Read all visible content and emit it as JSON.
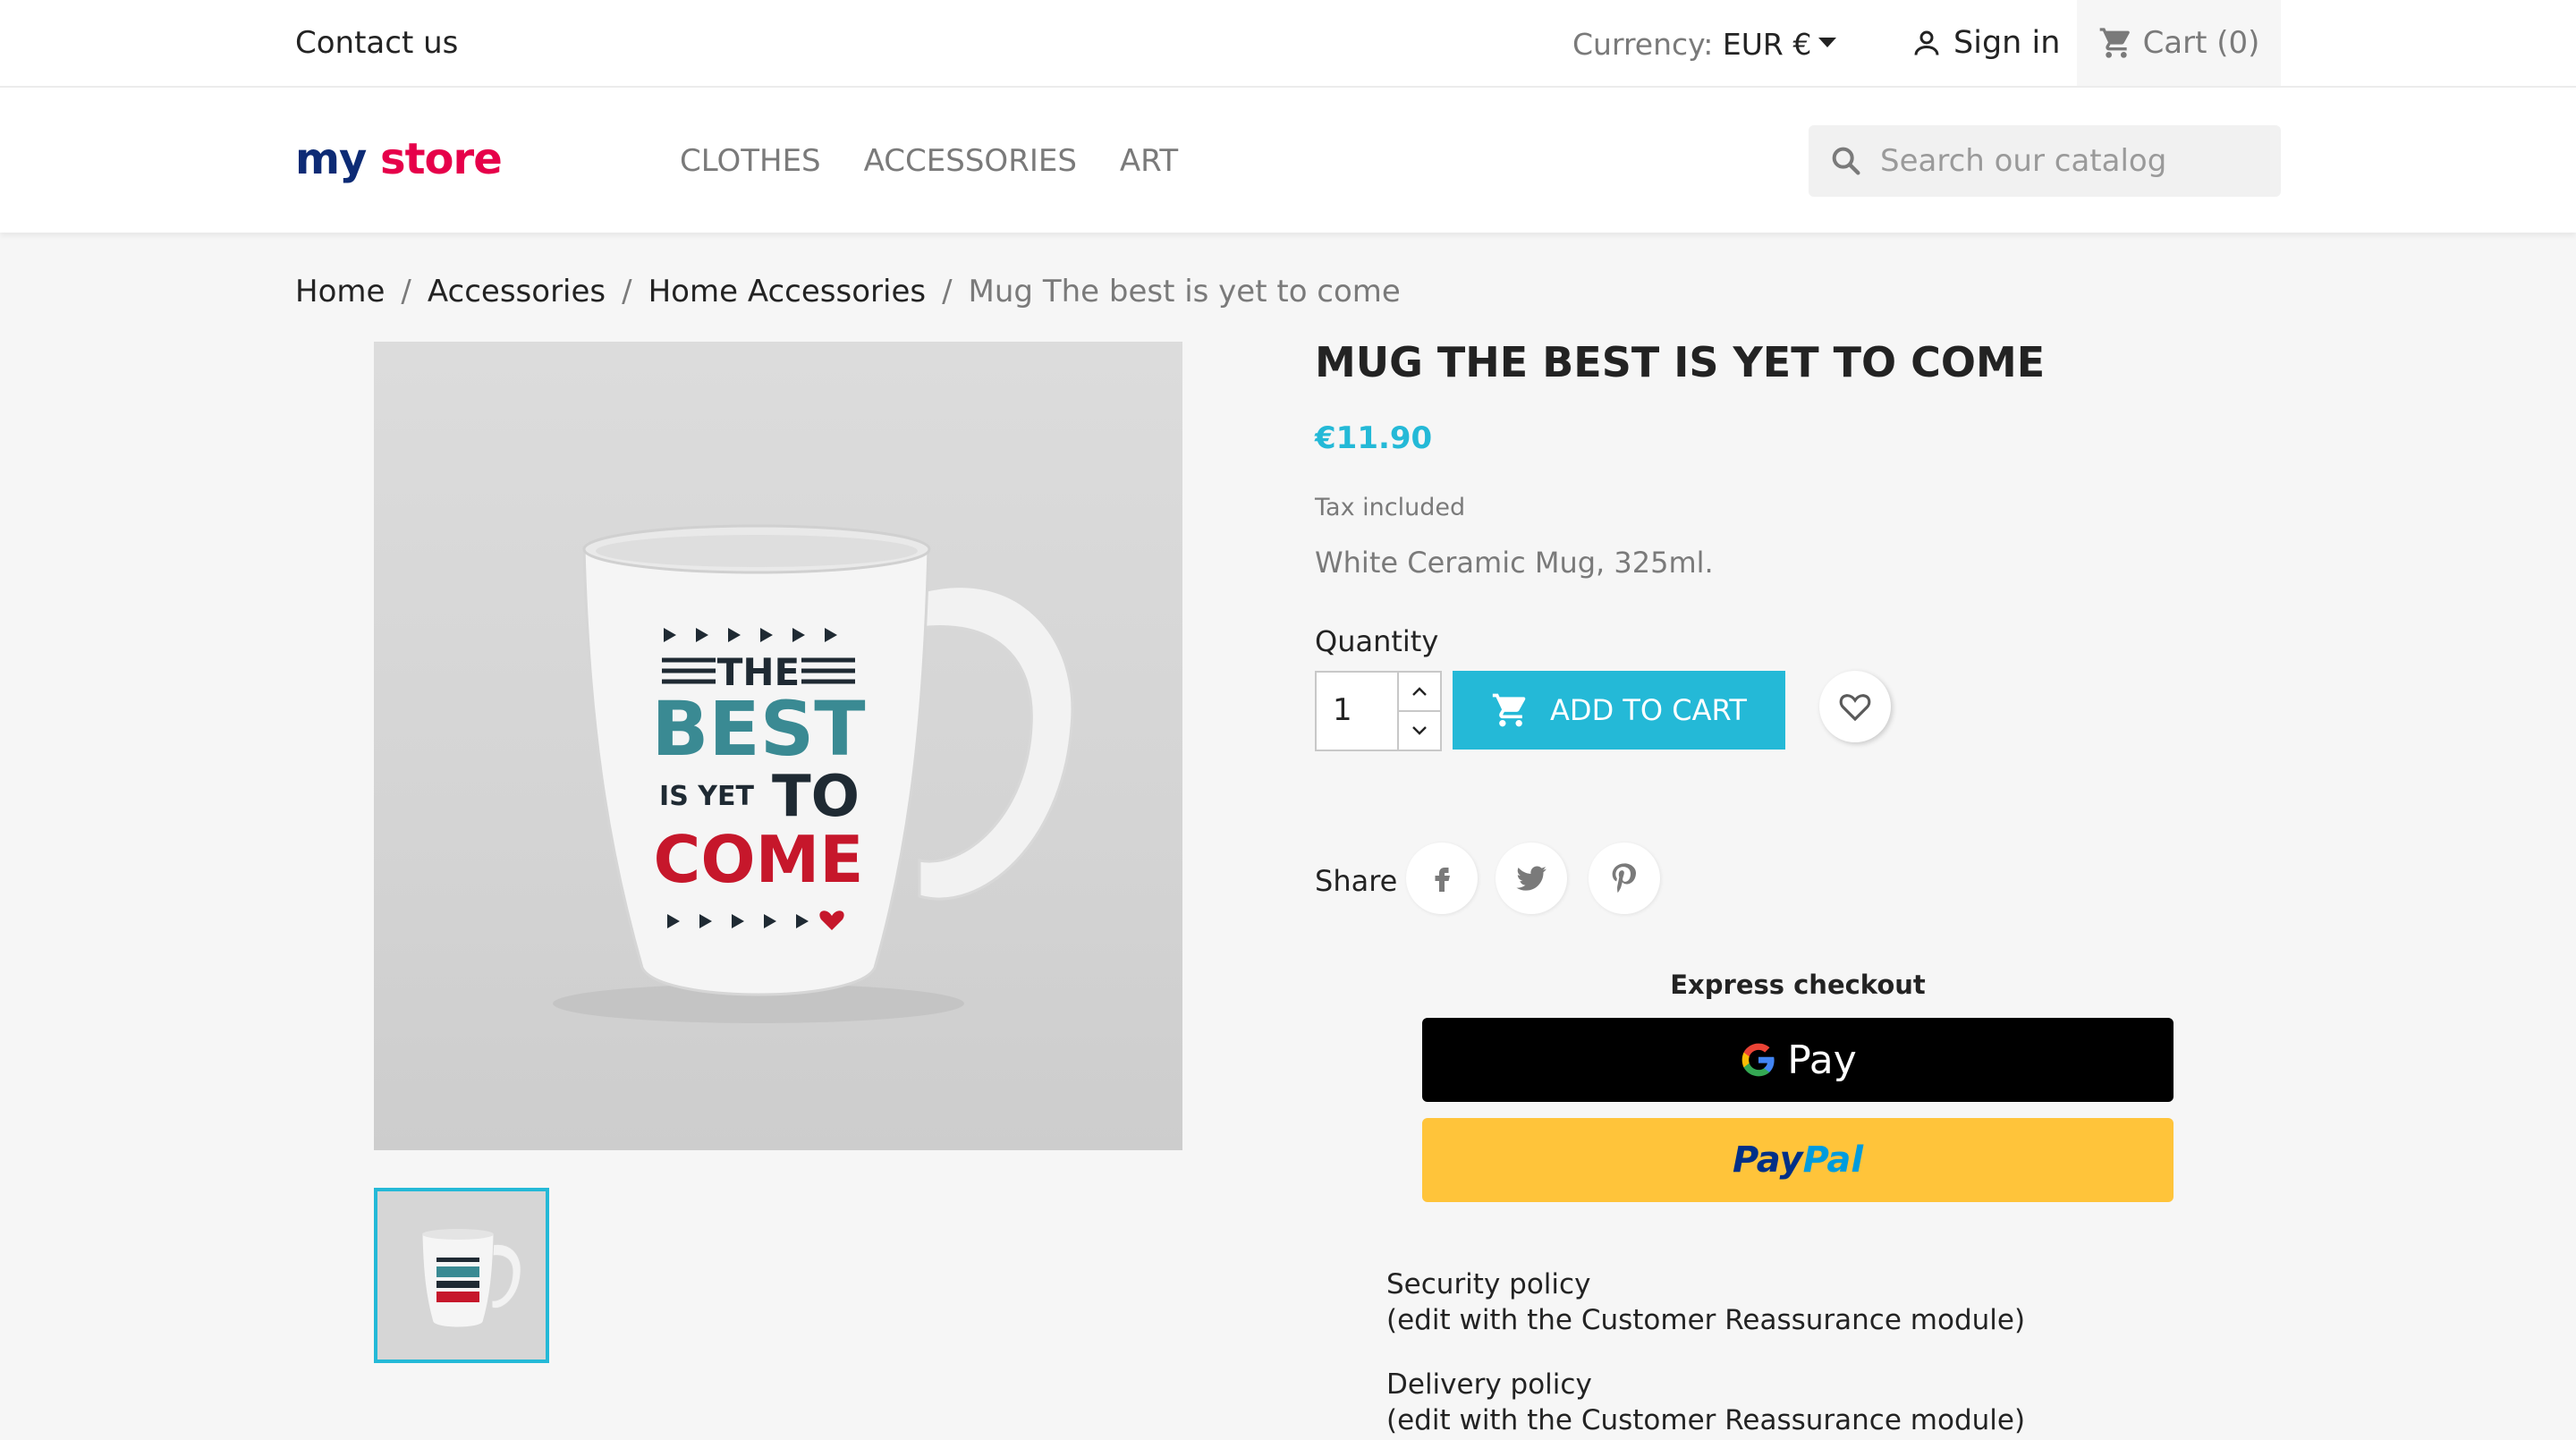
{
  "topbar": {
    "contact": "Contact us",
    "currency_label": "Currency:",
    "currency_value": "EUR €",
    "signin": "Sign in",
    "cart": "Cart (0)"
  },
  "header": {
    "logo_part1": "my",
    "logo_part2": "store",
    "nav": [
      "CLOTHES",
      "ACCESSORIES",
      "ART"
    ],
    "search_placeholder": "Search our catalog"
  },
  "breadcrumb": {
    "items": [
      "Home",
      "Accessories",
      "Home Accessories"
    ],
    "current": "Mug The best is yet to come",
    "separator": "/"
  },
  "product": {
    "title": "MUG THE BEST IS YET TO COME",
    "price": "€11.90",
    "tax": "Tax included",
    "description": "White Ceramic Mug, 325ml.",
    "quantity_label": "Quantity",
    "quantity": "1",
    "add_to_cart": "ADD TO CART",
    "share_label": "Share",
    "mug_text": {
      "the": "THE",
      "best": "BEST",
      "is_yet": "IS YET",
      "to": "TO",
      "come": "COME"
    }
  },
  "checkout": {
    "express_label": "Express checkout",
    "gpay_label": "Pay",
    "paypal_part1": "Pay",
    "paypal_part2": "Pal"
  },
  "reassurance": [
    {
      "title": "Security policy",
      "note": "(edit with the Customer Reassurance module)"
    },
    {
      "title": "Delivery policy",
      "note": "(edit with the Customer Reassurance module)"
    }
  ],
  "colors": {
    "accent": "#24b9d7",
    "mug_teal": "#3a8a93",
    "mug_red": "#c6172b",
    "mug_dark": "#1f2a33",
    "paypal_yellow": "#ffc43a"
  },
  "icons": [
    "person-icon",
    "cart-icon",
    "search-icon",
    "chevron-up-icon",
    "chevron-down-icon",
    "cart-icon",
    "heart-icon",
    "facebook-icon",
    "twitter-icon",
    "pinterest-icon",
    "google-g-icon"
  ]
}
